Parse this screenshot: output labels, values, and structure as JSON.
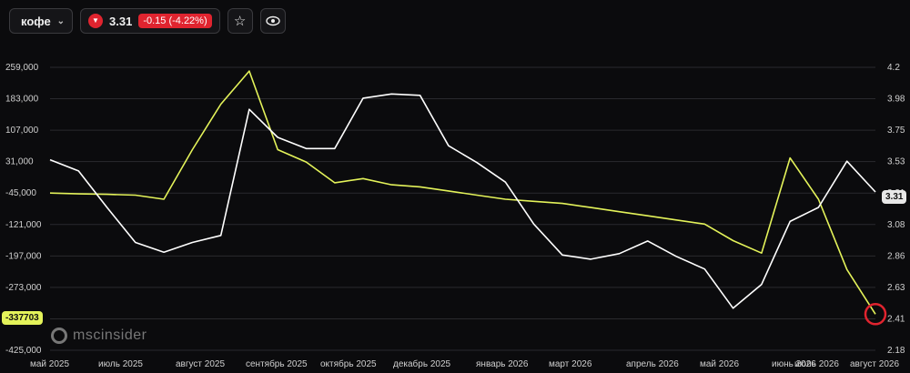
{
  "toolbar": {
    "asset_label": "кофе",
    "price": "3.31",
    "change": "-0.15 (-4.22%)",
    "star_icon": "star-icon",
    "eye_icon": "eye-icon"
  },
  "watermark": "mscinsider",
  "current_tags": {
    "left": "-337703",
    "right": "3.31"
  },
  "colors": {
    "net_positions": "#e4f35a",
    "price": "#ffffff",
    "negative": "#e0242f",
    "grid": "#2a2a2e"
  },
  "chart_data": {
    "type": "line",
    "title": "",
    "x_ticks": [
      "май 2025",
      "июль 2025",
      "август 2025",
      "сентябрь 2025",
      "октябрь 2025",
      "декабрь 2025",
      "январь 2026",
      "март 2026",
      "апрель 2026",
      "май 2026",
      "июнь 2026",
      "июль 2026",
      "август 2026"
    ],
    "left_axis": {
      "ticks": [
        "259,000",
        "183,000",
        "107,000",
        "31,000",
        "-45,000",
        "-121,000",
        "-197,000",
        "-273,000",
        "-349,000",
        "-425,000"
      ],
      "ylim": [
        -425000,
        259000
      ]
    },
    "right_axis": {
      "ticks": [
        "4.2",
        "3.98",
        "3.75",
        "3.53",
        "3.31",
        "3.08",
        "2.86",
        "2.63",
        "2.41",
        "2.18"
      ],
      "ylim": [
        2.18,
        4.2
      ]
    },
    "x": [
      "2025-05",
      "2025-06",
      "2025-07",
      "2025-08",
      "2025-09",
      "2025-10",
      "2025-11",
      "2025-12",
      "2026-01",
      "2026-02",
      "2026-03",
      "2026-04",
      "2026-05",
      "2026-06",
      "2026-07",
      "2026-08"
    ],
    "series": [
      {
        "axis": "left",
        "color": "#e4f35a",
        "values": [
          -45000,
          -47000,
          -48000,
          -50000,
          -60000,
          60000,
          170000,
          250000,
          60000,
          30000,
          -20000,
          -10000,
          -25000,
          -30000,
          -40000,
          -50000,
          -60000,
          -65000,
          -70000,
          -80000,
          -90000,
          -100000,
          -110000,
          -120000,
          -160000,
          -190000,
          40000,
          -60000,
          -230000,
          -337703
        ]
      },
      {
        "axis": "right",
        "color": "#ffffff",
        "values": [
          3.54,
          3.46,
          3.2,
          2.95,
          2.88,
          2.95,
          3.0,
          3.9,
          3.7,
          3.62,
          3.62,
          3.98,
          4.01,
          4.0,
          3.64,
          3.52,
          3.38,
          3.08,
          2.86,
          2.83,
          2.87,
          2.96,
          2.85,
          2.76,
          2.48,
          2.65,
          3.1,
          3.2,
          3.53,
          3.31
        ]
      }
    ],
    "current_values": {
      "left": -337703,
      "right": 3.31
    }
  }
}
